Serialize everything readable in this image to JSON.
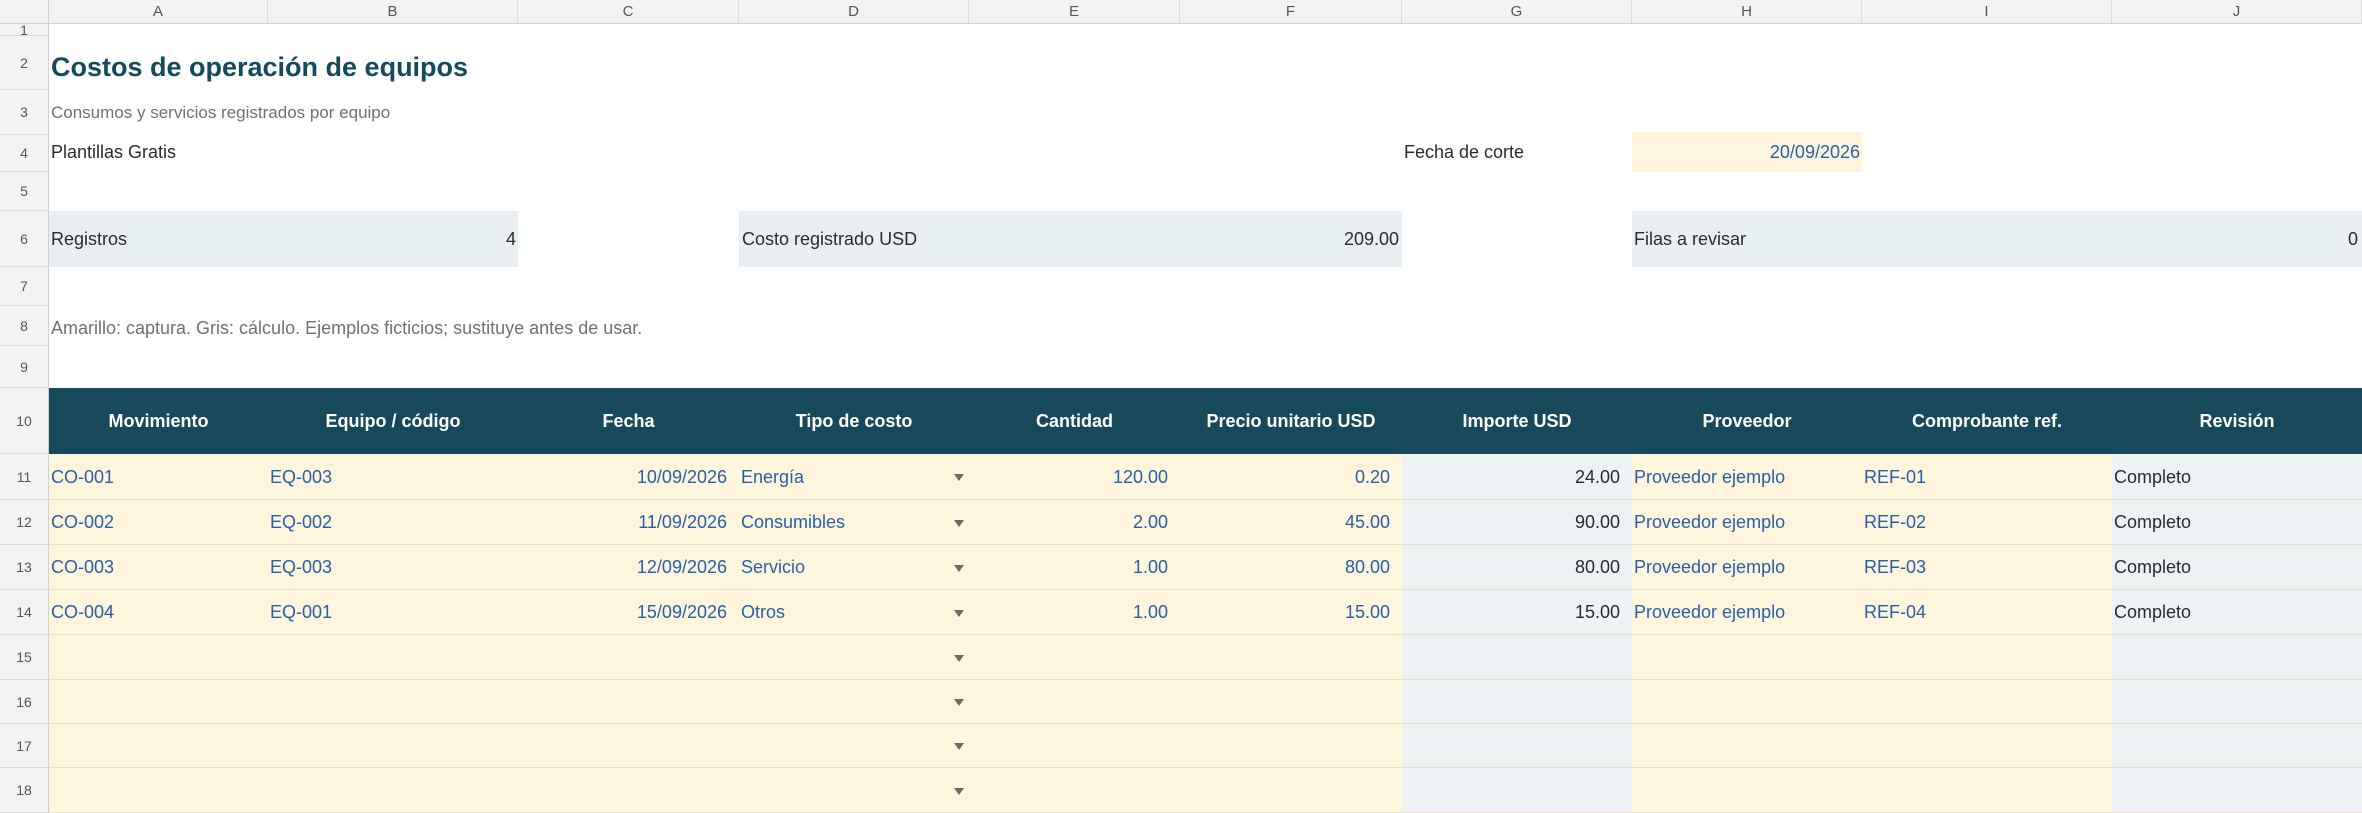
{
  "columns": [
    "A",
    "B",
    "C",
    "D",
    "E",
    "F",
    "G",
    "H",
    "I",
    "J"
  ],
  "rows": [
    "1",
    "2",
    "3",
    "4",
    "5",
    "6",
    "7",
    "8",
    "9",
    "10",
    "11",
    "12",
    "13",
    "14",
    "15",
    "16",
    "17",
    "18"
  ],
  "sheet": {
    "title": "Costos de operación de equipos",
    "subtitle": "Consumos y servicios registrados por equipo",
    "brand": "Plantillas Gratis",
    "cutoff_label": "Fecha de corte",
    "cutoff_value": "20/09/2026",
    "note": "Amarillo: captura. Gris: cálculo. Ejemplos ficticios; sustituye antes de usar."
  },
  "kpis": {
    "registros_label": "Registros",
    "registros_value": "4",
    "costo_label": "Costo registrado USD",
    "costo_value": "209.00",
    "revisar_label": "Filas a revisar",
    "revisar_value": "0"
  },
  "table": {
    "headers": [
      "Movimiento",
      "Equipo / código",
      "Fecha",
      "Tipo de costo",
      "Cantidad",
      "Precio unitario USD",
      "Importe USD",
      "Proveedor",
      "Comprobante ref.",
      "Revisión"
    ],
    "rows": [
      [
        "CO-001",
        "EQ-003",
        "10/09/2026",
        "Energía",
        "120.00",
        "0.20",
        "24.00",
        "Proveedor ejemplo",
        "REF-01",
        "Completo"
      ],
      [
        "CO-002",
        "EQ-002",
        "11/09/2026",
        "Consumibles",
        "2.00",
        "45.00",
        "90.00",
        "Proveedor ejemplo",
        "REF-02",
        "Completo"
      ],
      [
        "CO-003",
        "EQ-003",
        "12/09/2026",
        "Servicio",
        "1.00",
        "80.00",
        "80.00",
        "Proveedor ejemplo",
        "REF-03",
        "Completo"
      ],
      [
        "CO-004",
        "EQ-001",
        "15/09/2026",
        "Otros",
        "1.00",
        "15.00",
        "15.00",
        "Proveedor ejemplo",
        "REF-04",
        "Completo"
      ],
      [
        "",
        "",
        "",
        "",
        "",
        "",
        "",
        "",
        "",
        ""
      ],
      [
        "",
        "",
        "",
        "",
        "",
        "",
        "",
        "",
        "",
        ""
      ],
      [
        "",
        "",
        "",
        "",
        "",
        "",
        "",
        "",
        "",
        ""
      ],
      [
        "",
        "",
        "",
        "",
        "",
        "",
        "",
        "",
        "",
        ""
      ]
    ]
  },
  "icons": {
    "dropdown": "chevron-down-icon"
  },
  "colors": {
    "header": "#17495c",
    "input": "#fdf5dc",
    "calc": "#eef2f5",
    "kpi": "#e9f0f3",
    "link": "#2a5ea8"
  }
}
